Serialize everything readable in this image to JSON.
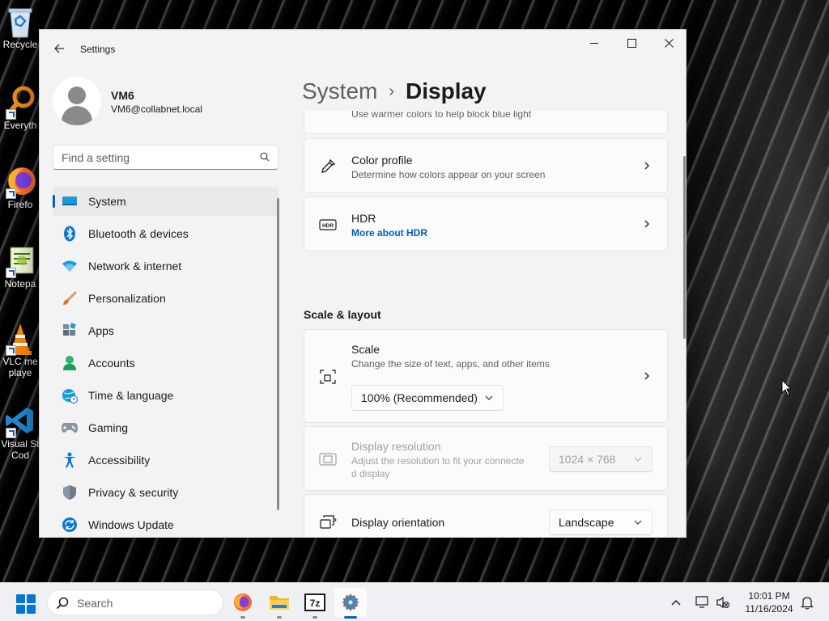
{
  "desktop": {
    "icons": [
      {
        "label": "Recycle",
        "name": "recycle-bin"
      },
      {
        "label": "Everyth",
        "name": "everything"
      },
      {
        "label": "Firefo",
        "name": "firefox"
      },
      {
        "label": "Notepa",
        "name": "notepad"
      },
      {
        "label": "VLC me",
        "label2": "playe",
        "name": "vlc"
      },
      {
        "label": "Visual St",
        "label2": "Cod",
        "name": "vscode"
      }
    ]
  },
  "window": {
    "app_title": "Settings",
    "user": {
      "name": "VM6",
      "email": "VM6@collabnet.local"
    },
    "search": {
      "placeholder": "Find a setting"
    },
    "nav": [
      {
        "label": "System",
        "icon": "monitor-icon",
        "active": true
      },
      {
        "label": "Bluetooth & devices",
        "icon": "bluetooth-icon"
      },
      {
        "label": "Network & internet",
        "icon": "wifi-icon"
      },
      {
        "label": "Personalization",
        "icon": "brush-icon"
      },
      {
        "label": "Apps",
        "icon": "apps-icon"
      },
      {
        "label": "Accounts",
        "icon": "person-icon"
      },
      {
        "label": "Time & language",
        "icon": "globe-clock-icon"
      },
      {
        "label": "Gaming",
        "icon": "gamepad-icon"
      },
      {
        "label": "Accessibility",
        "icon": "accessibility-icon"
      },
      {
        "label": "Privacy & security",
        "icon": "shield-icon"
      },
      {
        "label": "Windows Update",
        "icon": "update-icon"
      }
    ],
    "breadcrumb": {
      "parent": "System",
      "separator": "›",
      "current": "Display"
    },
    "cards": {
      "night_light_sub": "Use warmer colors to help block blue light",
      "color_profile": {
        "title": "Color profile",
        "sub": "Determine how colors appear on your screen"
      },
      "hdr": {
        "title": "HDR",
        "link": "More about HDR"
      },
      "section_scale_layout": "Scale & layout",
      "scale": {
        "title": "Scale",
        "sub": "Change the size of text, apps, and other items",
        "value": "100% (Recommended)"
      },
      "resolution": {
        "title": "Display resolution",
        "sub_line1": "Adjust the resolution to fit your connecte",
        "sub_line2": "d display",
        "value": "1024 × 768",
        "disabled": true
      },
      "orientation": {
        "title": "Display orientation",
        "value": "Landscape"
      }
    }
  },
  "taskbar": {
    "search_label": "Search",
    "apps": [
      "firefox",
      "file-explorer",
      "7zip",
      "settings"
    ],
    "seven_zip_label": "7z",
    "time": "10:01 PM",
    "date": "11/16/2024"
  },
  "colors": {
    "accent": "#005fb8",
    "start": "#0078d4"
  }
}
